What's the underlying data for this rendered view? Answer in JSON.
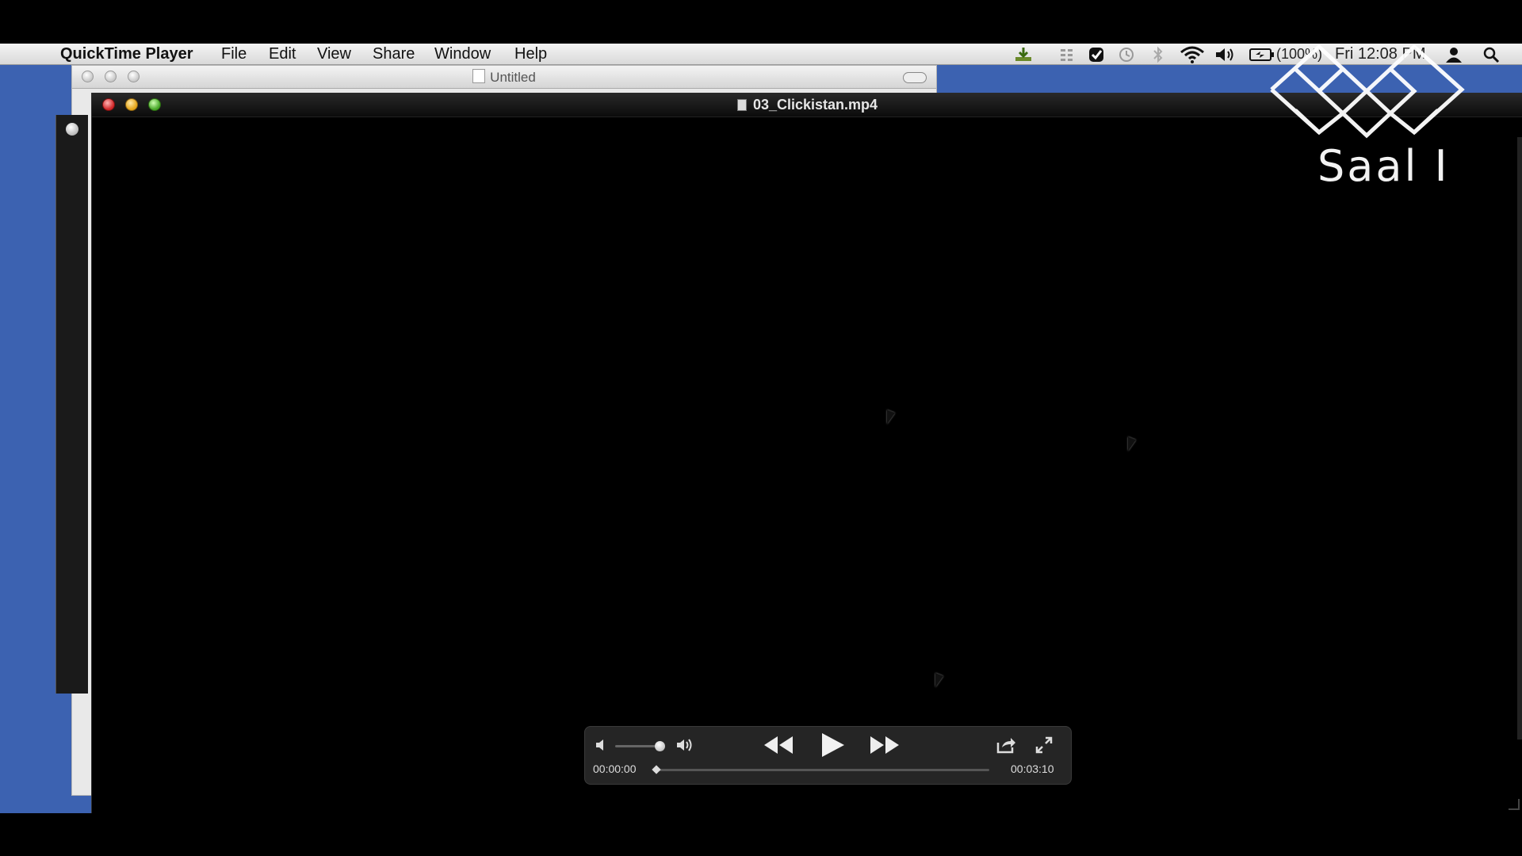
{
  "menubar": {
    "app_name": "QuickTime Player",
    "items": [
      "File",
      "Edit",
      "View",
      "Share",
      "Window",
      "Help"
    ],
    "battery": "(100%)",
    "clock": "Fri 12:08 PM"
  },
  "background_window": {
    "title": "Untitled"
  },
  "player": {
    "filename": "03_Clickistan.mp4",
    "current_time": "00:00:00",
    "duration": "00:03:10",
    "volume_level": 0.9,
    "progress": 0.0
  },
  "watermark": {
    "text": "Saal I"
  },
  "icons": {
    "apple": "apple-icon",
    "download": "download-icon",
    "wifi": "wifi-icon",
    "volume": "volume-icon",
    "battery": "battery-icon",
    "user": "user-icon",
    "spotlight": "spotlight-search-icon"
  },
  "colors": {
    "desktop": "#3c62b1",
    "player_bg": "#000000",
    "hud_bg": "#282828"
  }
}
